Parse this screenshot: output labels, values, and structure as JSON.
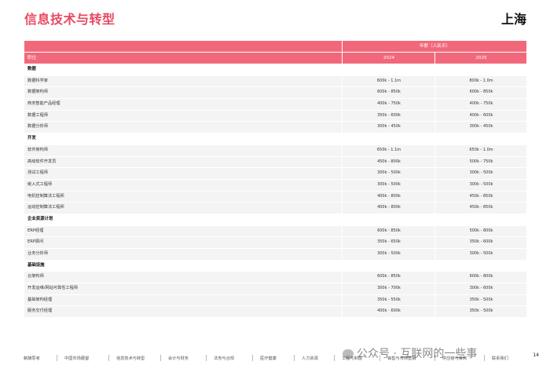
{
  "page": {
    "title": "信息技术与转型",
    "city": "上海",
    "page_number": "14"
  },
  "table": {
    "header": {
      "salary": "年薪（人民币）",
      "role": "职位",
      "year1": "2024",
      "year2": "2025"
    },
    "rows": [
      {
        "type": "cat",
        "name": "数据"
      },
      {
        "type": "item",
        "name": "数据科学家",
        "y2024": "600k - 1.1m",
        "y2025": "800k - 1.0m"
      },
      {
        "type": "item",
        "name": "数据架构师",
        "y2024": "600k - 850k",
        "y2025": "600k - 850k"
      },
      {
        "type": "item",
        "name": "商务智能产品经理",
        "y2024": "400k - 750k",
        "y2025": "400k - 750k"
      },
      {
        "type": "item",
        "name": "数据工程师",
        "y2024": "350k - 600k",
        "y2025": "400k - 600k"
      },
      {
        "type": "item",
        "name": "数据分析师",
        "y2024": "300k - 450k",
        "y2025": "300k - 450k"
      },
      {
        "type": "cat",
        "name": "开发"
      },
      {
        "type": "item",
        "name": "软件架构师",
        "y2024": "650k - 1.1m",
        "y2025": "650k - 1.0m"
      },
      {
        "type": "item",
        "name": "高级软件开发员",
        "y2024": "450k - 800k",
        "y2025": "500k - 750k"
      },
      {
        "type": "item",
        "name": "测试工程师",
        "y2024": "300k - 500k",
        "y2025": "300k - 500k"
      },
      {
        "type": "item",
        "name": "嵌入式工程师",
        "y2024": "300k - 500k",
        "y2025": "300k - 500k"
      },
      {
        "type": "item",
        "name": "电机控制算法工程师",
        "y2024": "400k - 800k",
        "y2025": "450k - 850k"
      },
      {
        "type": "item",
        "name": "运动控制算法工程师",
        "y2024": "400k - 800k",
        "y2025": "450k - 850k"
      },
      {
        "type": "cat",
        "name": "企业资源计划"
      },
      {
        "type": "item",
        "name": "ERP经理",
        "y2024": "600k - 850k",
        "y2025": "500k - 800k"
      },
      {
        "type": "item",
        "name": "ERP顾问",
        "y2024": "350k - 650k",
        "y2025": "350k - 600k"
      },
      {
        "type": "item",
        "name": "业务分析师",
        "y2024": "300k - 500k",
        "y2025": "300k - 500k"
      },
      {
        "type": "cat",
        "name": "基础设施"
      },
      {
        "type": "item",
        "name": "云架构师",
        "y2024": "600k - 850k",
        "y2025": "600k - 800k"
      },
      {
        "type": "item",
        "name": "开发运维/网站可靠性工程师",
        "y2024": "300k - 700k",
        "y2025": "300k - 600k"
      },
      {
        "type": "item",
        "name": "基础架构经理",
        "y2024": "350k - 550k",
        "y2025": "350k - 500k"
      },
      {
        "type": "item",
        "name": "服务交付经理",
        "y2024": "400k - 600k",
        "y2025": "350k - 500k"
      }
    ]
  },
  "footer": {
    "nav": [
      "薪酬思考",
      "中国市场展望",
      "信息技术与转型",
      "会计与财务",
      "法务与合规",
      "医疗健康",
      "人力资源",
      "工程与制造",
      "销售与市场营销",
      "供应链与采购",
      "联系我们"
    ],
    "watermark": "公众号 · 互联网的一些事"
  }
}
